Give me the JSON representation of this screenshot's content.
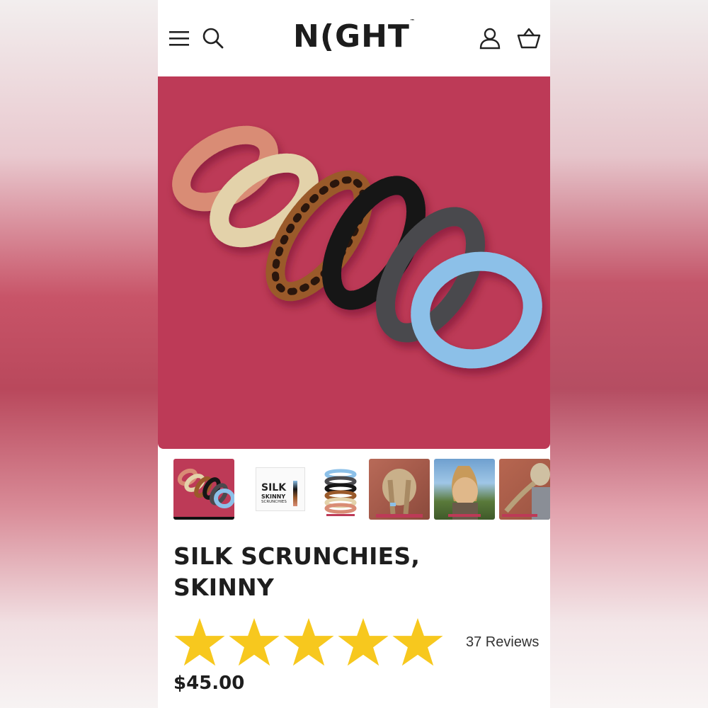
{
  "brand": {
    "logo_text": "N(GHT"
  },
  "header": {
    "menu_icon": "hamburger-menu-icon",
    "search_icon": "search-icon",
    "account_icon": "user-icon",
    "cart_icon": "basket-icon"
  },
  "hero": {
    "background_color": "#bd3a57",
    "scrunchie_colors": [
      "#d98c75",
      "#e3d2aa",
      "#9a5a2a",
      "#151515",
      "#4a4a4e",
      "#8cc0e8"
    ]
  },
  "gallery": {
    "thumbnails": [
      {
        "label": "scrunchies-set"
      },
      {
        "label": "package",
        "text_lines": [
          "SILK",
          "SKINNY",
          "SCRUNCHIES"
        ]
      },
      {
        "label": "stacked-scrunchies"
      },
      {
        "label": "braids-model"
      },
      {
        "label": "ponytail-model"
      },
      {
        "label": "long-braid-model"
      }
    ],
    "active_index": 0
  },
  "product": {
    "title_line1": "SILK SCRUNCHIES,",
    "title_line2": "SKINNY",
    "rating": 5,
    "rating_max": 5,
    "star_color": "#f7c81e",
    "reviews_text": "37 Reviews",
    "price": "$45.00"
  }
}
